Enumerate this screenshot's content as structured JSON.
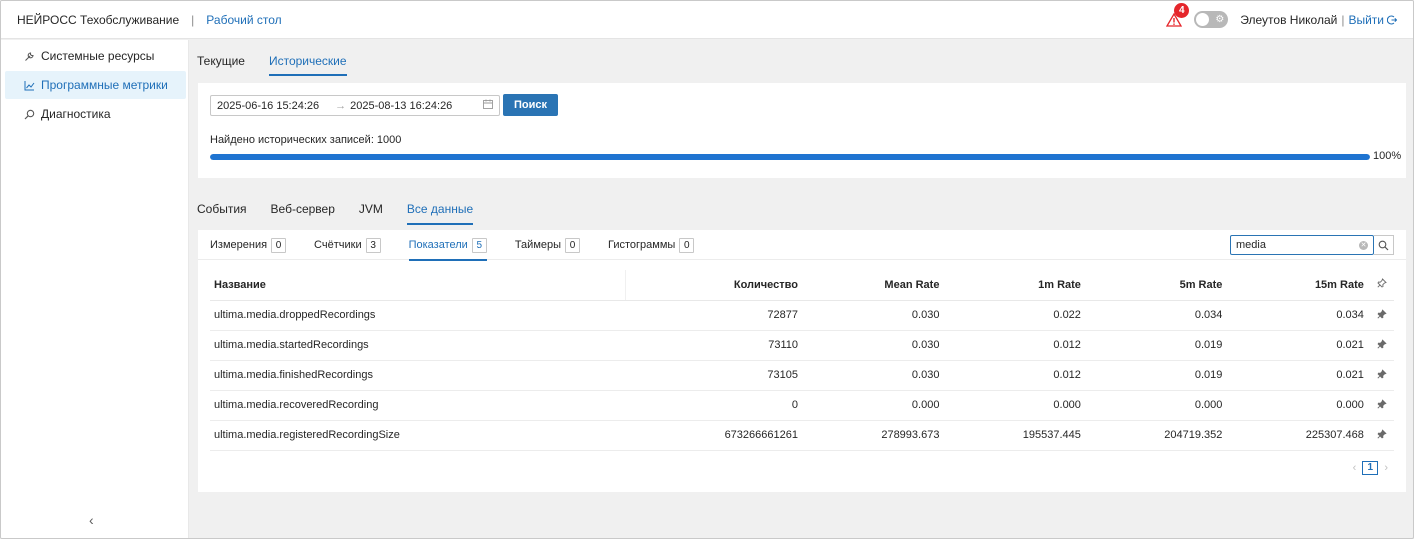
{
  "header": {
    "app_name": "НЕЙРОСС Техобслуживание",
    "separator": "|",
    "desktop_link": "Рабочий стол",
    "alert_count": "4",
    "user_name": "Элеутов Николай",
    "user_sep": "|",
    "logout": "Выйти"
  },
  "sidebar": {
    "items": [
      {
        "label": "Системные ресурсы",
        "icon": "wrench-icon"
      },
      {
        "label": "Программные метрики",
        "icon": "chart-line-icon"
      },
      {
        "label": "Диагностика",
        "icon": "search-magnifier-icon"
      }
    ],
    "active_index": 1
  },
  "top_tabs": [
    {
      "label": "Текущие"
    },
    {
      "label": "Исторические"
    }
  ],
  "search": {
    "from": "2025-06-16 15:24:26",
    "to": "2025-08-13 16:24:26",
    "button": "Поиск",
    "found": "Найдено исторических записей: 1000",
    "progress_percent": 100,
    "progress_label": "100%"
  },
  "mid_tabs": [
    {
      "label": "События"
    },
    {
      "label": "Веб-сервер"
    },
    {
      "label": "JVM"
    },
    {
      "label": "Все данные"
    }
  ],
  "sub_tabs": [
    {
      "label": "Измерения",
      "count": "0"
    },
    {
      "label": "Счётчики",
      "count": "3"
    },
    {
      "label": "Показатели",
      "count": "5"
    },
    {
      "label": "Таймеры",
      "count": "0"
    },
    {
      "label": "Гистограммы",
      "count": "0"
    }
  ],
  "filter": {
    "value": "media"
  },
  "table": {
    "columns": [
      "Название",
      "Количество",
      "Mean Rate",
      "1m Rate",
      "5m Rate",
      "15m Rate"
    ],
    "rows": [
      [
        "ultima.media.droppedRecordings",
        "72877",
        "0.030",
        "0.022",
        "0.034",
        "0.034"
      ],
      [
        "ultima.media.startedRecordings",
        "73110",
        "0.030",
        "0.012",
        "0.019",
        "0.021"
      ],
      [
        "ultima.media.finishedRecordings",
        "73105",
        "0.030",
        "0.012",
        "0.019",
        "0.021"
      ],
      [
        "ultima.media.recoveredRecording",
        "0",
        "0.000",
        "0.000",
        "0.000",
        "0.000"
      ],
      [
        "ultima.media.registeredRecordingSize",
        "673266661261",
        "278993.673",
        "195537.445",
        "204719.352",
        "225307.468"
      ]
    ]
  },
  "pager": {
    "current": "1",
    "prev": "‹",
    "next": "›"
  },
  "colors": {
    "accent": "#1f6fb8",
    "button": "#2a74b4",
    "progress": "#1f74d1",
    "badge": "#e5262b"
  }
}
